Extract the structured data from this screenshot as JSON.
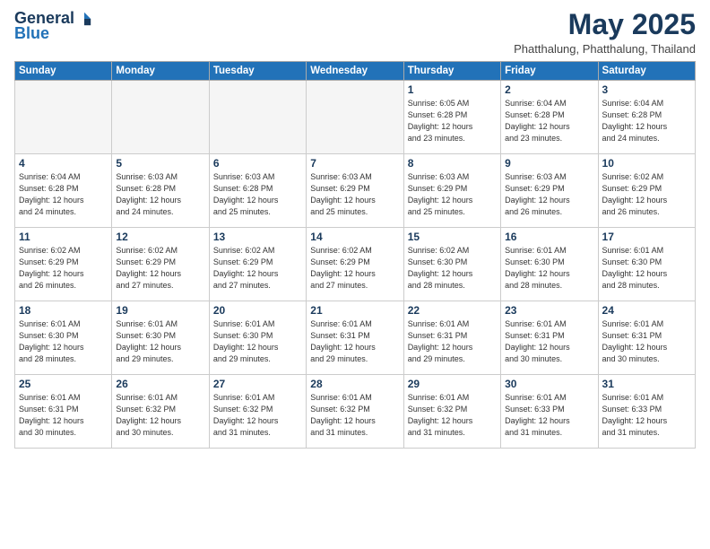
{
  "logo": {
    "general": "General",
    "blue": "Blue"
  },
  "title": "May 2025",
  "location": "Phatthalung, Phatthalung, Thailand",
  "days_of_week": [
    "Sunday",
    "Monday",
    "Tuesday",
    "Wednesday",
    "Thursday",
    "Friday",
    "Saturday"
  ],
  "weeks": [
    [
      {
        "day": "",
        "info": ""
      },
      {
        "day": "",
        "info": ""
      },
      {
        "day": "",
        "info": ""
      },
      {
        "day": "",
        "info": ""
      },
      {
        "day": "1",
        "info": "Sunrise: 6:05 AM\nSunset: 6:28 PM\nDaylight: 12 hours\nand 23 minutes."
      },
      {
        "day": "2",
        "info": "Sunrise: 6:04 AM\nSunset: 6:28 PM\nDaylight: 12 hours\nand 23 minutes."
      },
      {
        "day": "3",
        "info": "Sunrise: 6:04 AM\nSunset: 6:28 PM\nDaylight: 12 hours\nand 24 minutes."
      }
    ],
    [
      {
        "day": "4",
        "info": "Sunrise: 6:04 AM\nSunset: 6:28 PM\nDaylight: 12 hours\nand 24 minutes."
      },
      {
        "day": "5",
        "info": "Sunrise: 6:03 AM\nSunset: 6:28 PM\nDaylight: 12 hours\nand 24 minutes."
      },
      {
        "day": "6",
        "info": "Sunrise: 6:03 AM\nSunset: 6:28 PM\nDaylight: 12 hours\nand 25 minutes."
      },
      {
        "day": "7",
        "info": "Sunrise: 6:03 AM\nSunset: 6:29 PM\nDaylight: 12 hours\nand 25 minutes."
      },
      {
        "day": "8",
        "info": "Sunrise: 6:03 AM\nSunset: 6:29 PM\nDaylight: 12 hours\nand 25 minutes."
      },
      {
        "day": "9",
        "info": "Sunrise: 6:03 AM\nSunset: 6:29 PM\nDaylight: 12 hours\nand 26 minutes."
      },
      {
        "day": "10",
        "info": "Sunrise: 6:02 AM\nSunset: 6:29 PM\nDaylight: 12 hours\nand 26 minutes."
      }
    ],
    [
      {
        "day": "11",
        "info": "Sunrise: 6:02 AM\nSunset: 6:29 PM\nDaylight: 12 hours\nand 26 minutes."
      },
      {
        "day": "12",
        "info": "Sunrise: 6:02 AM\nSunset: 6:29 PM\nDaylight: 12 hours\nand 27 minutes."
      },
      {
        "day": "13",
        "info": "Sunrise: 6:02 AM\nSunset: 6:29 PM\nDaylight: 12 hours\nand 27 minutes."
      },
      {
        "day": "14",
        "info": "Sunrise: 6:02 AM\nSunset: 6:29 PM\nDaylight: 12 hours\nand 27 minutes."
      },
      {
        "day": "15",
        "info": "Sunrise: 6:02 AM\nSunset: 6:30 PM\nDaylight: 12 hours\nand 28 minutes."
      },
      {
        "day": "16",
        "info": "Sunrise: 6:01 AM\nSunset: 6:30 PM\nDaylight: 12 hours\nand 28 minutes."
      },
      {
        "day": "17",
        "info": "Sunrise: 6:01 AM\nSunset: 6:30 PM\nDaylight: 12 hours\nand 28 minutes."
      }
    ],
    [
      {
        "day": "18",
        "info": "Sunrise: 6:01 AM\nSunset: 6:30 PM\nDaylight: 12 hours\nand 28 minutes."
      },
      {
        "day": "19",
        "info": "Sunrise: 6:01 AM\nSunset: 6:30 PM\nDaylight: 12 hours\nand 29 minutes."
      },
      {
        "day": "20",
        "info": "Sunrise: 6:01 AM\nSunset: 6:30 PM\nDaylight: 12 hours\nand 29 minutes."
      },
      {
        "day": "21",
        "info": "Sunrise: 6:01 AM\nSunset: 6:31 PM\nDaylight: 12 hours\nand 29 minutes."
      },
      {
        "day": "22",
        "info": "Sunrise: 6:01 AM\nSunset: 6:31 PM\nDaylight: 12 hours\nand 29 minutes."
      },
      {
        "day": "23",
        "info": "Sunrise: 6:01 AM\nSunset: 6:31 PM\nDaylight: 12 hours\nand 30 minutes."
      },
      {
        "day": "24",
        "info": "Sunrise: 6:01 AM\nSunset: 6:31 PM\nDaylight: 12 hours\nand 30 minutes."
      }
    ],
    [
      {
        "day": "25",
        "info": "Sunrise: 6:01 AM\nSunset: 6:31 PM\nDaylight: 12 hours\nand 30 minutes."
      },
      {
        "day": "26",
        "info": "Sunrise: 6:01 AM\nSunset: 6:32 PM\nDaylight: 12 hours\nand 30 minutes."
      },
      {
        "day": "27",
        "info": "Sunrise: 6:01 AM\nSunset: 6:32 PM\nDaylight: 12 hours\nand 31 minutes."
      },
      {
        "day": "28",
        "info": "Sunrise: 6:01 AM\nSunset: 6:32 PM\nDaylight: 12 hours\nand 31 minutes."
      },
      {
        "day": "29",
        "info": "Sunrise: 6:01 AM\nSunset: 6:32 PM\nDaylight: 12 hours\nand 31 minutes."
      },
      {
        "day": "30",
        "info": "Sunrise: 6:01 AM\nSunset: 6:33 PM\nDaylight: 12 hours\nand 31 minutes."
      },
      {
        "day": "31",
        "info": "Sunrise: 6:01 AM\nSunset: 6:33 PM\nDaylight: 12 hours\nand 31 minutes."
      }
    ]
  ]
}
